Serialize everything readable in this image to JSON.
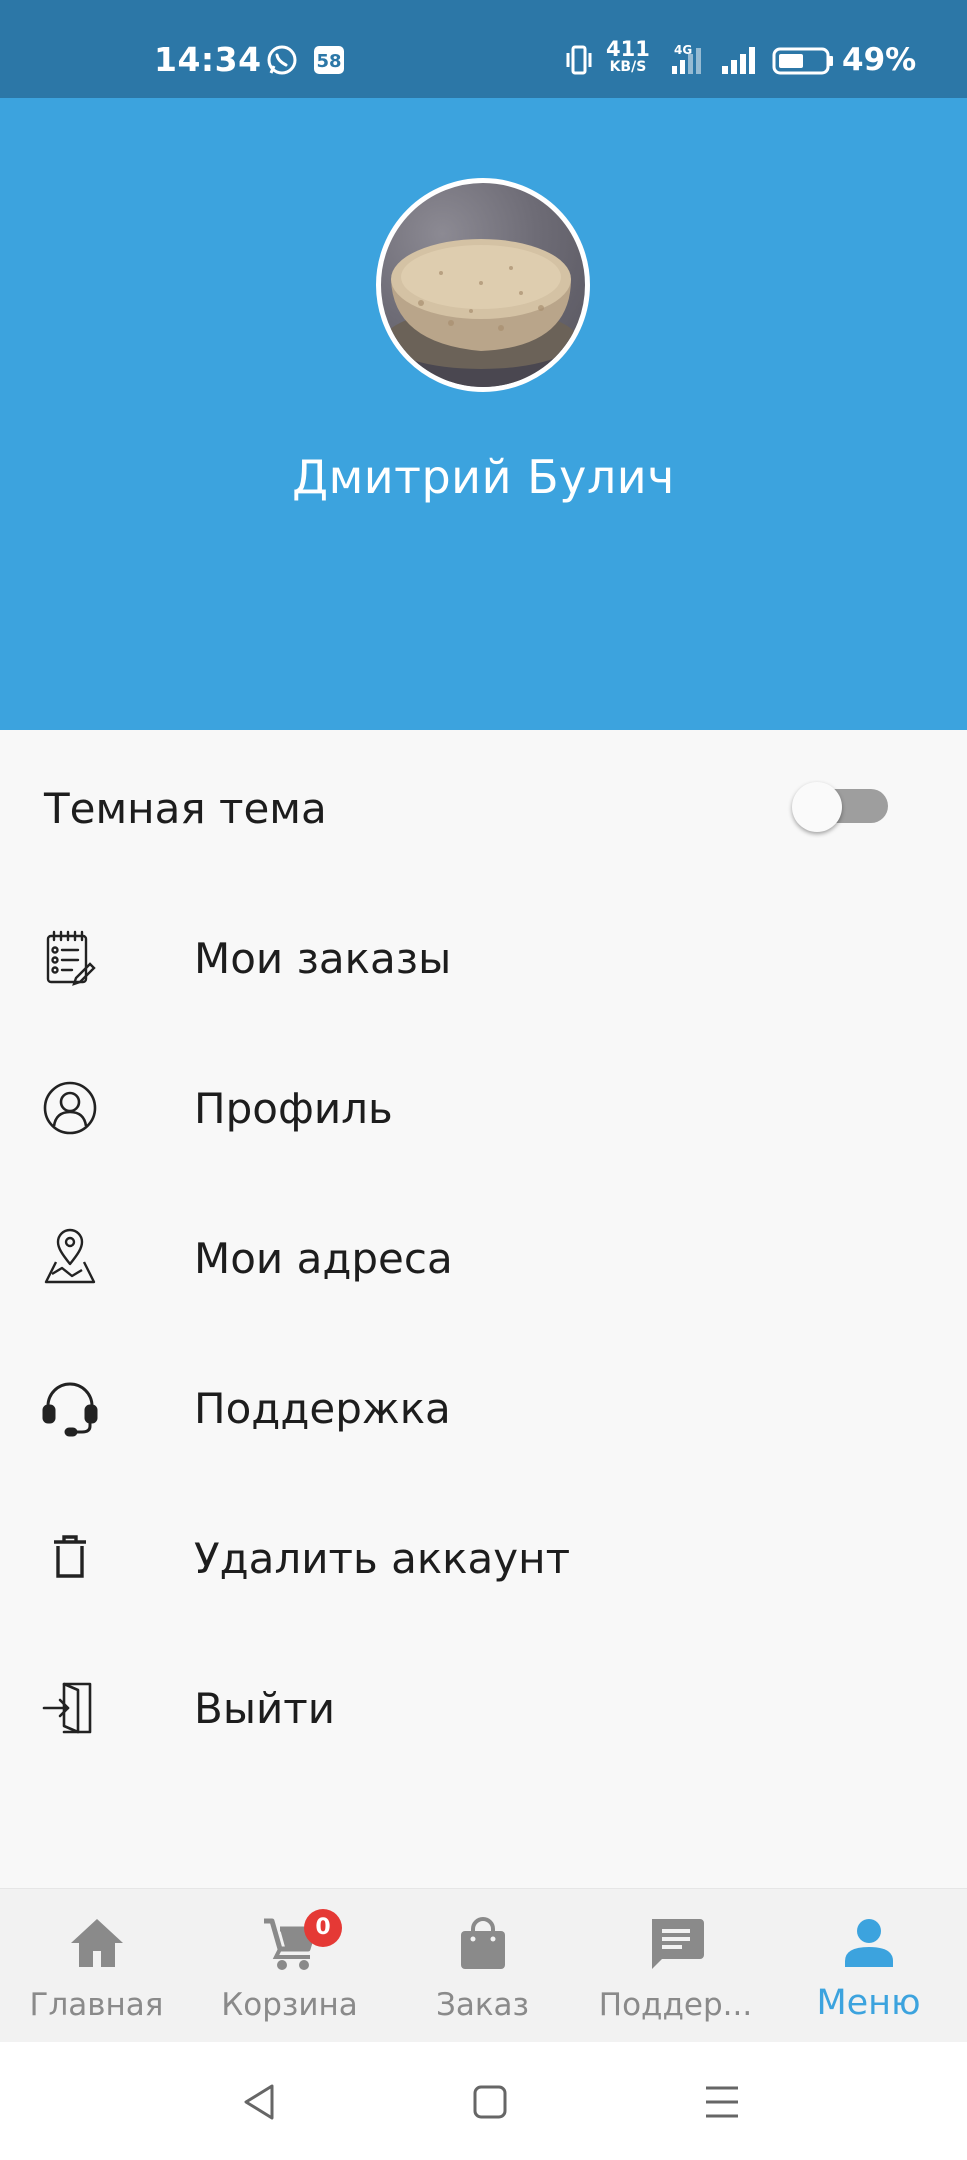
{
  "status_bar": {
    "time": "14:34",
    "net_speed_value": "411",
    "net_speed_unit": "KB/S",
    "network_type": "4G",
    "battery_percent": "49%"
  },
  "profile": {
    "name": "Дмитрий Булич"
  },
  "settings": {
    "dark_theme_label": "Темная тема",
    "dark_theme_enabled": false
  },
  "menu": {
    "items": [
      {
        "label": "Мои заказы",
        "icon": "orders-icon"
      },
      {
        "label": "Профиль",
        "icon": "profile-icon"
      },
      {
        "label": "Мои адреса",
        "icon": "map-pin-icon"
      },
      {
        "label": "Поддержка",
        "icon": "headset-icon"
      },
      {
        "label": "Удалить аккаунт",
        "icon": "trash-icon"
      },
      {
        "label": "Выйти",
        "icon": "logout-icon"
      }
    ]
  },
  "bottom_nav": {
    "items": [
      {
        "label": "Главная",
        "icon": "home-icon"
      },
      {
        "label": "Корзина",
        "icon": "cart-icon"
      },
      {
        "label": "Заказ",
        "icon": "shopping-bag-icon"
      },
      {
        "label": "Поддер...",
        "icon": "chat-icon"
      },
      {
        "label": "Меню",
        "icon": "person-icon"
      }
    ],
    "active_index": 4,
    "cart_badge": "0"
  },
  "colors": {
    "status_bar": "#2c77a7",
    "header": "#3ca3de",
    "accent": "#3ca3de",
    "badge": "#e53935"
  }
}
